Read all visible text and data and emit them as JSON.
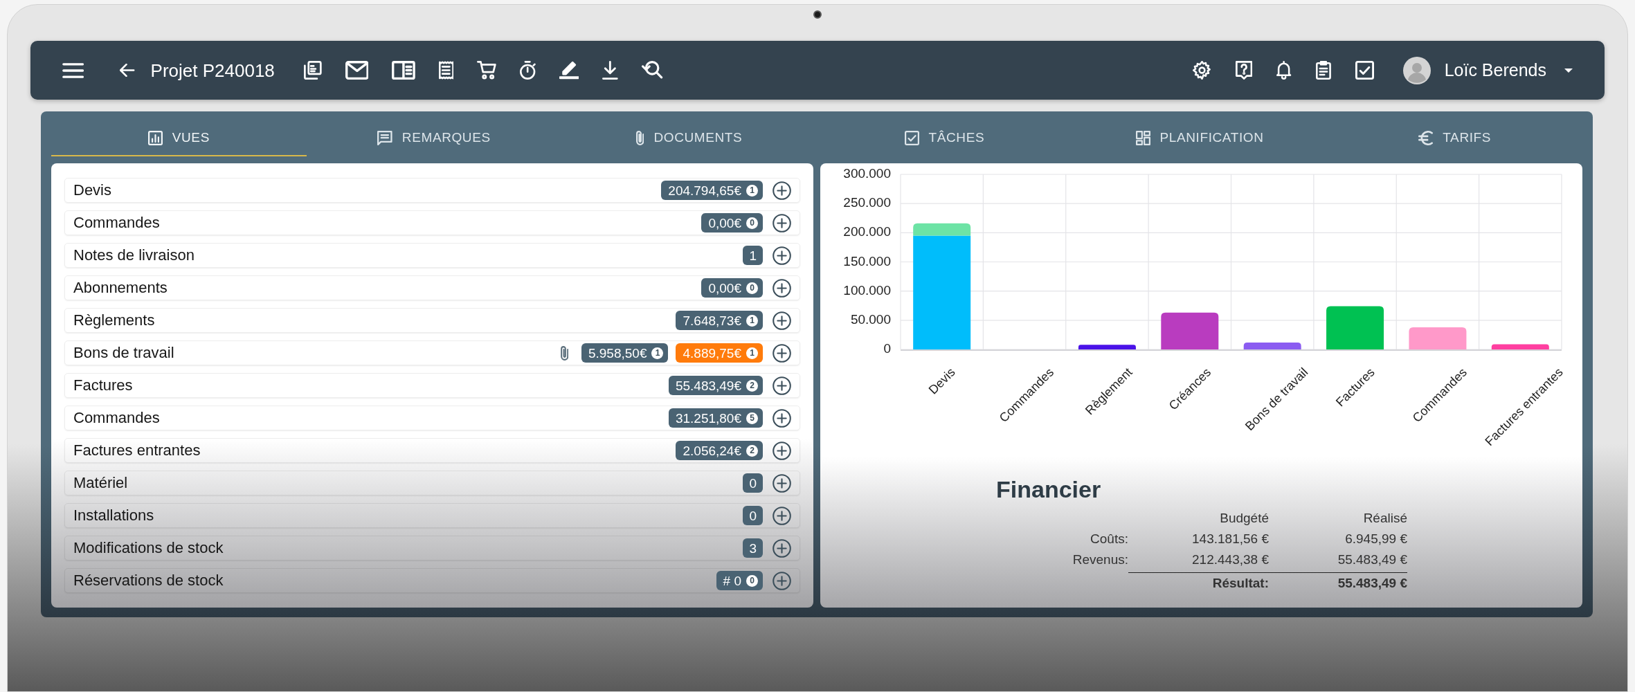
{
  "header": {
    "title": "Projet P240018",
    "user_name": "Loïc Berends"
  },
  "tabs": [
    {
      "label": "VUES",
      "selected": true
    },
    {
      "label": "REMARQUES",
      "selected": false
    },
    {
      "label": "DOCUMENTS",
      "selected": false
    },
    {
      "label": "TÂCHES",
      "selected": false
    },
    {
      "label": "PLANIFICATION",
      "selected": false
    },
    {
      "label": "TARIFS",
      "selected": false
    }
  ],
  "documents": [
    {
      "label": "Devis",
      "has_attachment": false,
      "badges": [
        {
          "value": "204.794,65€",
          "count": "1",
          "color": "#4a6373"
        }
      ]
    },
    {
      "label": "Commandes",
      "has_attachment": false,
      "badges": [
        {
          "value": "0,00€",
          "count": "0",
          "color": "#4a6373"
        }
      ]
    },
    {
      "label": "Notes de livraison",
      "has_attachment": false,
      "badges": [
        {
          "value": "1",
          "color": "#4a6373"
        }
      ]
    },
    {
      "label": "Abonnements",
      "has_attachment": false,
      "badges": [
        {
          "value": "0,00€",
          "count": "0",
          "color": "#4a6373"
        }
      ]
    },
    {
      "label": "Règlements",
      "has_attachment": false,
      "badges": [
        {
          "value": "7.648,73€",
          "count": "1",
          "color": "#4a6373"
        }
      ]
    },
    {
      "label": "Bons de travail",
      "has_attachment": true,
      "badges": [
        {
          "value": "5.958,50€",
          "count": "1",
          "color": "#4a6373"
        },
        {
          "value": "4.889,75€",
          "count": "1",
          "color": "#ff7b0b"
        }
      ]
    },
    {
      "label": "Factures",
      "has_attachment": false,
      "badges": [
        {
          "value": "55.483,49€",
          "count": "2",
          "color": "#4a6373"
        }
      ]
    },
    {
      "label": "Commandes",
      "has_attachment": false,
      "badges": [
        {
          "value": "31.251,80€",
          "count": "5",
          "color": "#4a6373"
        }
      ]
    },
    {
      "label": "Factures entrantes",
      "has_attachment": false,
      "badges": [
        {
          "value": "2.056,24€",
          "count": "2",
          "color": "#4a6373"
        }
      ]
    },
    {
      "label": "Matériel",
      "has_attachment": false,
      "badges": [
        {
          "value": "0",
          "color": "#4a6373"
        }
      ]
    },
    {
      "label": "Installations",
      "has_attachment": false,
      "badges": [
        {
          "value": "0",
          "color": "#4a6373"
        }
      ]
    },
    {
      "label": "Modifications de stock",
      "has_attachment": false,
      "badges": [
        {
          "value": "3",
          "color": "#4a6373"
        }
      ]
    },
    {
      "label": "Réservations de stock",
      "has_attachment": false,
      "badges": [
        {
          "value": "# 0",
          "count": "0",
          "color": "#4a6373"
        }
      ]
    }
  ],
  "chart": {
    "chart_data": {
      "type": "bar",
      "stacked": true,
      "grid": true,
      "categories": [
        "Devis",
        "Commandes",
        "Règlement",
        "Créances",
        "Bons de travail",
        "Factures",
        "Commandes",
        "Factures entrantes"
      ],
      "ylim": [
        0,
        300000
      ],
      "yticks": [
        {
          "value": 0,
          "label": "0"
        },
        {
          "value": 50000,
          "label": "50.000"
        },
        {
          "value": 100000,
          "label": "100.000"
        },
        {
          "value": 150000,
          "label": "150.000"
        },
        {
          "value": 200000,
          "label": "200.000"
        },
        {
          "value": 250000,
          "label": "250.000"
        },
        {
          "value": 300000,
          "label": "300.000"
        }
      ],
      "series": [
        {
          "color": "#00bdfb",
          "values": [
            195000,
            null,
            null,
            null,
            null,
            null,
            null,
            null
          ]
        },
        {
          "color": "#6de3a5",
          "values": [
            21000,
            null,
            null,
            null,
            null,
            null,
            null,
            null
          ]
        },
        {
          "color": "#4a12e8",
          "values": [
            null,
            null,
            8000,
            null,
            null,
            null,
            null,
            null
          ]
        },
        {
          "color": "#b93cbf",
          "values": [
            null,
            null,
            null,
            63000,
            null,
            null,
            null,
            null
          ]
        },
        {
          "color": "#8b5cf1",
          "values": [
            null,
            null,
            null,
            null,
            12000,
            null,
            null,
            null
          ]
        },
        {
          "color": "#00c152",
          "values": [
            null,
            null,
            null,
            null,
            null,
            74000,
            null,
            null
          ]
        },
        {
          "color": "#ff99c9",
          "values": [
            null,
            null,
            null,
            null,
            null,
            null,
            38000,
            null
          ]
        },
        {
          "color": "#ff3fa0",
          "values": [
            null,
            null,
            null,
            null,
            null,
            null,
            null,
            9000
          ]
        }
      ]
    }
  },
  "financial": {
    "title": "Financier",
    "columns": [
      "Budgété",
      "Réalisé"
    ],
    "rows": [
      {
        "label": "Coûts:",
        "values": [
          "143.181,56 €",
          "6.945,99 €"
        ]
      },
      {
        "label": "Revenus:",
        "values": [
          "212.443,38 €",
          "55.483,49 €"
        ]
      }
    ],
    "total": {
      "label": "Résultat:",
      "value": "55.483,49 €"
    }
  }
}
